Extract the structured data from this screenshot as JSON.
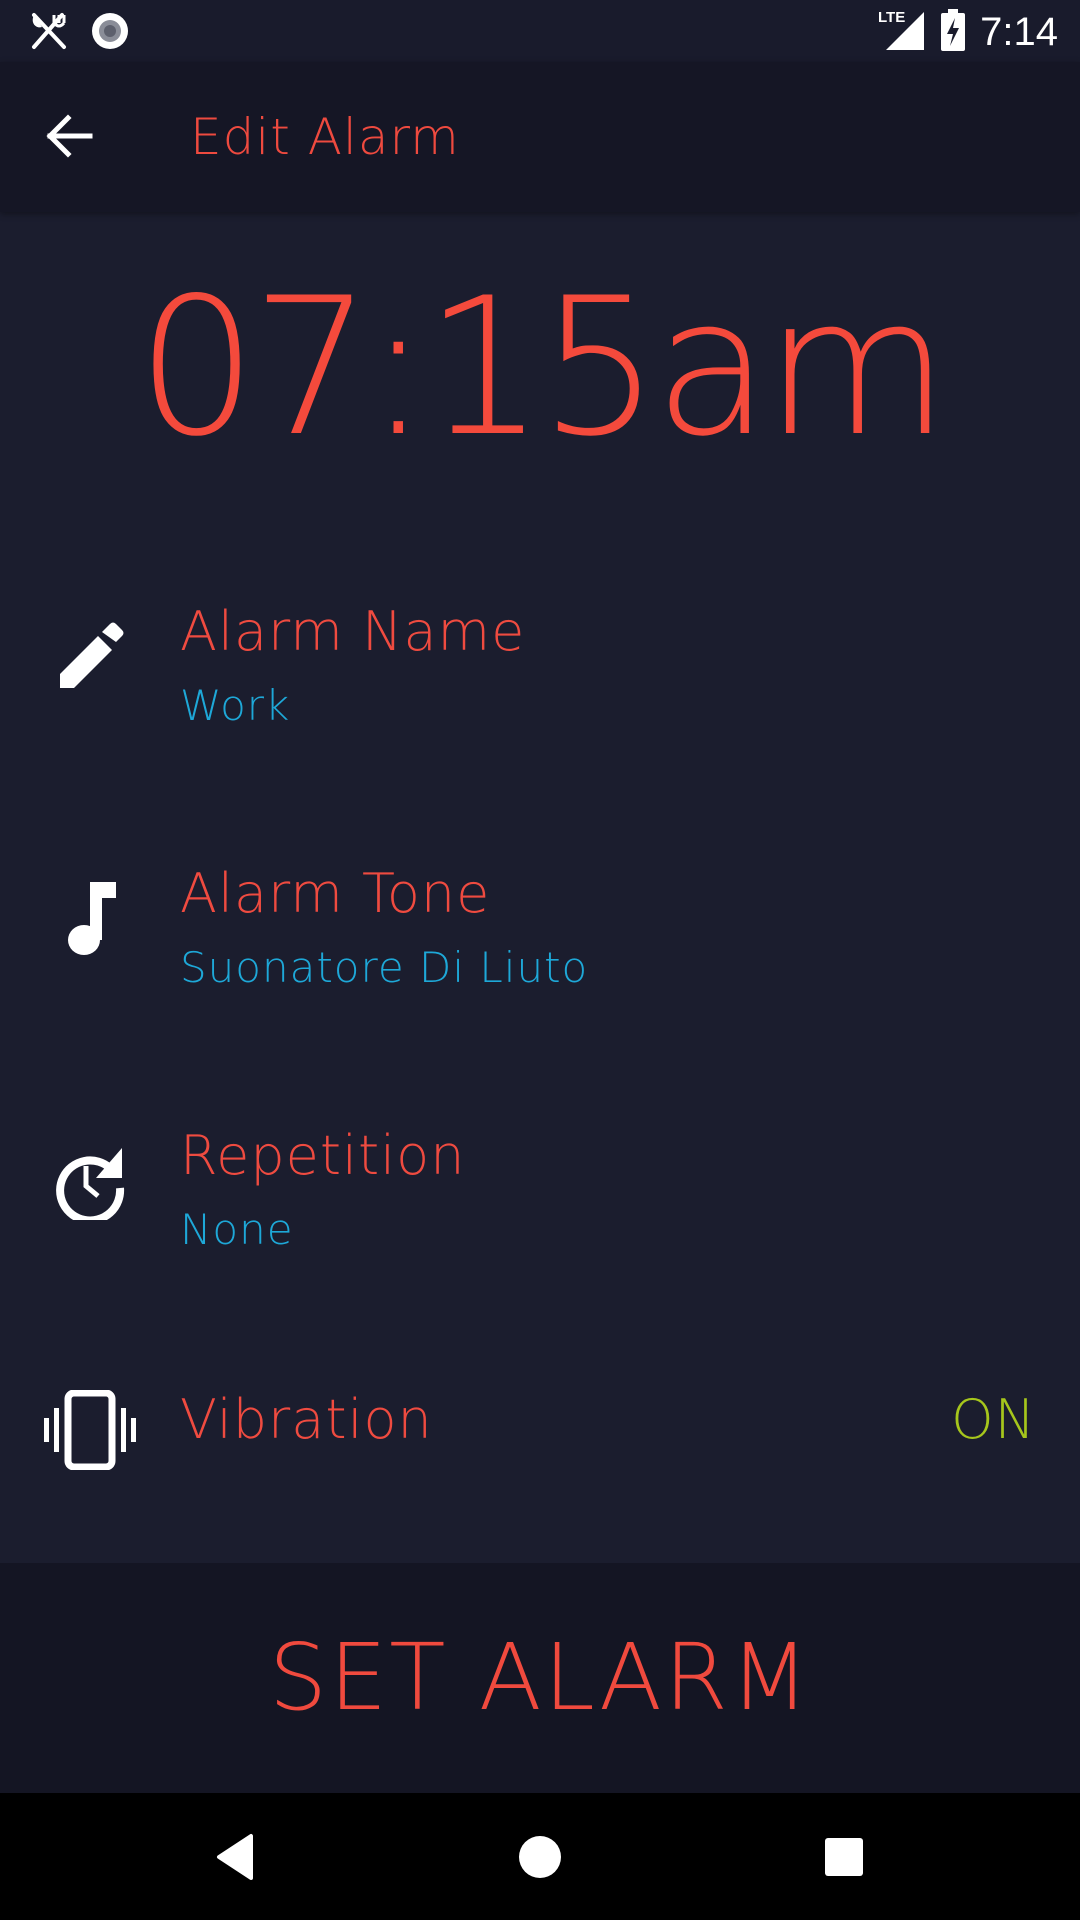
{
  "status_bar": {
    "time": "7:14",
    "network": "LTE",
    "icons": [
      "restaurant-icon",
      "record-icon",
      "lte-signal-icon",
      "battery-charging-icon"
    ]
  },
  "app_bar": {
    "title": "Edit Alarm",
    "back_icon": "arrow-back-icon"
  },
  "alarm": {
    "time": "07:15am"
  },
  "settings": [
    {
      "icon": "pencil-icon",
      "label": "Alarm Name",
      "value": "Work"
    },
    {
      "icon": "music-note-icon",
      "label": "Alarm Tone",
      "value": "Suonatore Di Liuto"
    },
    {
      "icon": "repeat-clock-icon",
      "label": "Repetition",
      "value": "None"
    },
    {
      "icon": "vibration-icon",
      "label": "Vibration",
      "value": "ON"
    }
  ],
  "action": {
    "set_alarm_label": "SET ALARM"
  },
  "nav_bar": {
    "buttons": [
      "back-triangle-icon",
      "home-circle-icon",
      "recents-square-icon"
    ]
  },
  "colors": {
    "background": "#1b1d2e",
    "app_bar": "#151625",
    "accent_red": "#f04a3e",
    "value_blue": "#1ea8d8",
    "toggle_green": "#a6c61c"
  }
}
